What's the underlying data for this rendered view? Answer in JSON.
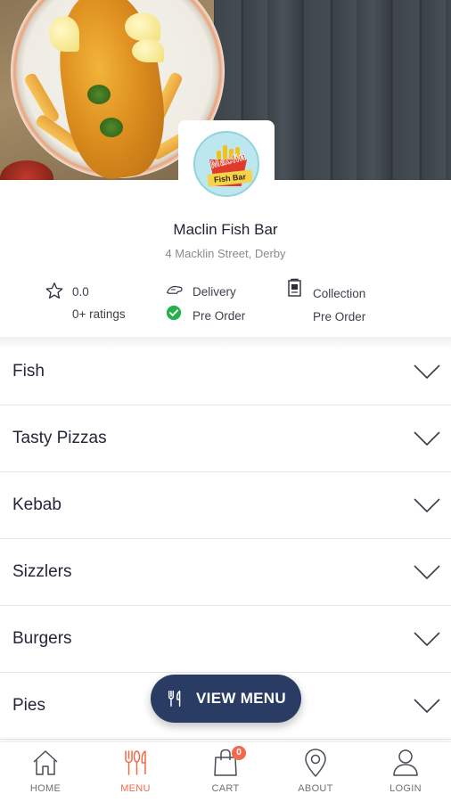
{
  "shop": {
    "name": "Maclin Fish Bar",
    "address": "4 Macklin Street, Derby",
    "logo_text_top": "Maclin",
    "logo_text_bottom": "Fish Bar"
  },
  "stats": {
    "rating_value": "0.0",
    "rating_count": "0+ ratings",
    "delivery_label": "Delivery",
    "delivery_status": "Pre Order",
    "collection_label": "Collection",
    "collection_status": "Pre Order"
  },
  "categories": [
    {
      "label": "Fish"
    },
    {
      "label": "Tasty Pizzas"
    },
    {
      "label": "Kebab"
    },
    {
      "label": "Sizzlers"
    },
    {
      "label": "Burgers"
    },
    {
      "label": "Pies"
    }
  ],
  "view_menu_label": "VIEW MENU",
  "nav": {
    "home": "HOME",
    "menu": "MENU",
    "cart": "CART",
    "cart_count": "0",
    "about": "ABOUT",
    "login": "LOGIN"
  },
  "colors": {
    "accent": "#f26a4b",
    "primary_button": "#2a3c63",
    "check_green": "#22b14c"
  },
  "icons": {
    "rating": "star-icon",
    "delivery": "delivery-icon",
    "delivery_status": "check-circle-icon",
    "collection": "collection-icon",
    "category_toggle": "chevron-down-icon",
    "view_menu": "cutlery-icon",
    "home": "home-icon",
    "menu": "cutlery-icon",
    "cart": "shopping-bag-icon",
    "about": "location-pin-icon",
    "login": "user-icon"
  }
}
